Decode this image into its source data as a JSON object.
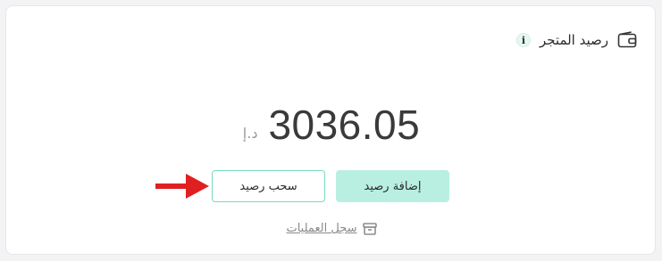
{
  "store_balance": {
    "title": "رصيد المتجر",
    "info_icon": "i",
    "amount": "3036.05",
    "currency": "د.إ",
    "add_button_label": "إضافة رصيد",
    "withdraw_button_label": "سحب رصيد",
    "history_link_label": "سجل العمليات",
    "icons": {
      "header": "wallet-icon",
      "info": "info-icon",
      "history": "archive-box-icon",
      "annotation": "red-arrow-icon"
    },
    "colors": {
      "add_button_bg": "#b8efe0",
      "withdraw_button_border": "#7ad9c2",
      "annotation_arrow": "#e02020"
    }
  }
}
